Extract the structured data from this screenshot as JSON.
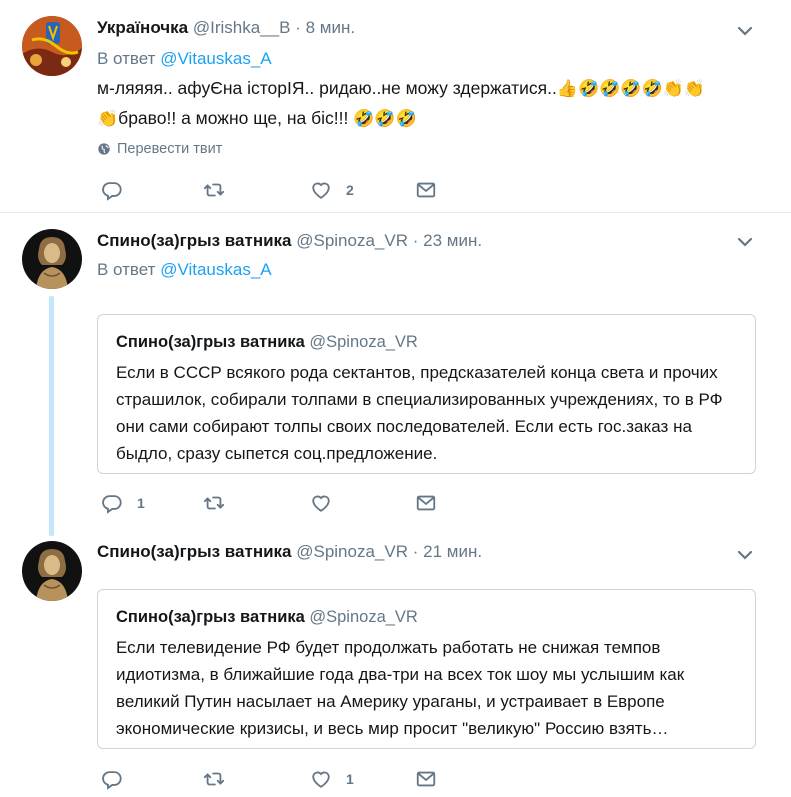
{
  "tweets": [
    {
      "name": "Україночка",
      "handle": "@Irishka__B",
      "sep": "·",
      "time": "8 мин.",
      "reply_prefix": "В ответ",
      "reply_to": "@Vitauskas_A",
      "text_line1": "м-ляяяя.. афуЄна історІЯ.. ридаю..не можу здержатися..",
      "text_line1_emoji": "👍🤣🤣🤣🤣👏👏",
      "text_line2_emoji_pre": "👏",
      "text_line2": "браво!! а можно ще, на біс!!! ",
      "text_line2_emoji_post": "🤣🤣🤣",
      "translate_label": "Перевести твит",
      "reply_count": "",
      "retweet_count": "",
      "like_count": "2"
    },
    {
      "name": "Спино(за)грыз ватника",
      "handle": "@Spinoza_VR",
      "sep": "·",
      "time": "23 мин.",
      "reply_prefix": "В ответ",
      "reply_to": "@Vitauskas_A",
      "quote_name": "Спино(за)грыз ватника",
      "quote_handle": "@Spinoza_VR",
      "quote_text": "Если в СССР всякого рода сектантов, предсказателей конца света и прочих страшилок, собирали толпами в специализированных учреждениях, то в РФ они сами собирают толпы своих последователей. Если есть гос.заказ на быдло, сразу сыпется соц.предложение.",
      "reply_count": "1",
      "retweet_count": "",
      "like_count": ""
    },
    {
      "name": "Спино(за)грыз ватника",
      "handle": "@Spinoza_VR",
      "sep": "·",
      "time": "21 мин.",
      "quote_name": "Спино(за)грыз ватника",
      "quote_handle": "@Spinoza_VR",
      "quote_text": "Если телевидение РФ будет продолжать работать не снижая темпов идиотизма, в ближайшие года два-три на всех ток шоу мы услышим как великий Путин насылает на Америку ураганы, и устраивает в Европе экономические кризисы, и весь мир просит \"великую\" Россию взять…",
      "reply_count": "",
      "retweet_count": "",
      "like_count": "1"
    }
  ],
  "icons": {
    "reply": "reply-icon",
    "retweet": "retweet-icon",
    "like": "heart-icon",
    "dm": "envelope-icon",
    "caret": "chevron-down-icon",
    "globe": "globe-icon"
  },
  "colors": {
    "link": "#1da1f2",
    "muted": "#657786",
    "text": "#14171a",
    "thread_line": "#c4e6fb",
    "border": "#e6ecf0"
  }
}
